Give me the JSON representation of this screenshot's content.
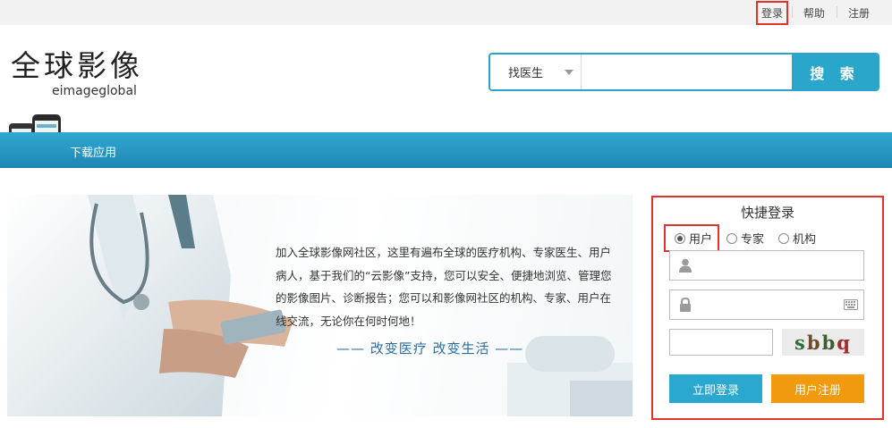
{
  "topbar": {
    "login": "登录",
    "help": "帮助",
    "register": "注册"
  },
  "logo": {
    "cn": "全球影像",
    "en": "eimageglobal"
  },
  "search": {
    "category": "找医生",
    "placeholder": "",
    "button": "搜 索"
  },
  "nav": {
    "download": "下载应用"
  },
  "banner": {
    "text": "加入全球影像网社区，这里有遍布全球的医疗机构、专家医生、用户病人，基于我们的“云影像”支持，您可以安全、便捷地浏览、管理您的影像图片、诊断报告；您可以和影像网社区的机构、专家、用户在线交流，无论你在何时何地！",
    "slogan": "—— 改变医疗    改变生活 ——"
  },
  "login": {
    "title": "快捷登录",
    "roles": [
      {
        "label": "用户",
        "selected": true
      },
      {
        "label": "专家",
        "selected": false
      },
      {
        "label": "机构",
        "selected": false
      }
    ],
    "username": "",
    "password": "",
    "captcha_input": "",
    "captcha": [
      "s",
      "b",
      "b",
      "q"
    ],
    "login_button": "立即登录",
    "register_button": "用户注册"
  },
  "colors": {
    "accent": "#2ba6cb",
    "highlight": "#e1322e",
    "orange": "#f29a0f"
  }
}
